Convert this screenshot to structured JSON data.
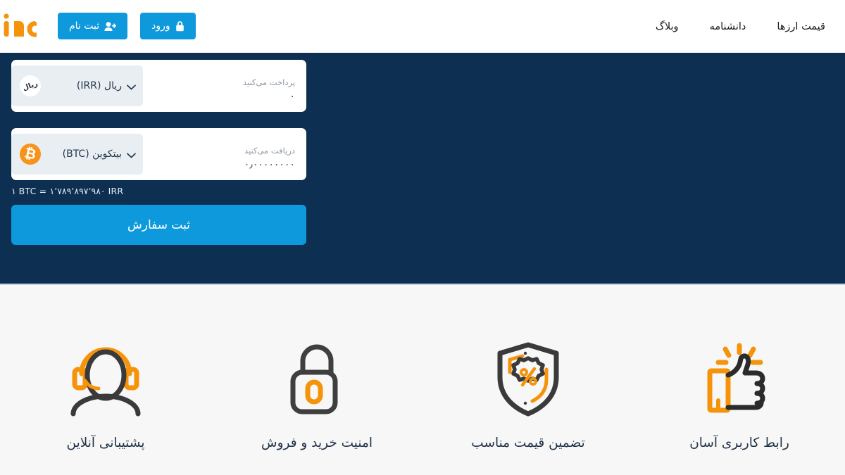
{
  "header": {
    "logo_text": "ino",
    "logo_color": "#f5a300",
    "buttons": [
      {
        "label": "ثبت نام",
        "icon": "user-plus-icon"
      },
      {
        "label": "ورود",
        "icon": "lock-icon"
      }
    ],
    "nav_links": [
      {
        "label": "قیمت ارزها"
      },
      {
        "label": "دانشنامه"
      },
      {
        "label": "وبلاگ"
      }
    ]
  },
  "hero": {
    "background_color": "#0c2f52",
    "pay_field": {
      "label": "پرداخت می‌کنید",
      "value": "۰",
      "currency_name": "ریال (IRR)",
      "currency_symbol": "ریال",
      "currency_icon": "irr-coin-icon"
    },
    "receive_field": {
      "label": "دریافت می‌کنید",
      "value": "۰٫۰۰۰۰۰۰۰۰",
      "currency_name": "بیتکوین (BTC)",
      "currency_symbol": "₿",
      "currency_icon": "btc-coin-icon"
    },
    "rate_text": "۱ BTC = ۱٬۷۸۹٬۸۹۷٬۹۸۰ IRR",
    "submit_label": "ثبت سفارش",
    "accent_color": "#0d99dc"
  },
  "features": [
    {
      "label": "پشتیبانی آنلاین",
      "icon": "headset-support-icon"
    },
    {
      "label": "امنیت خرید و فروش",
      "icon": "padlock-icon"
    },
    {
      "label": "تضمین قیمت مناسب",
      "icon": "shield-percent-icon"
    },
    {
      "label": "رابط کاربری آسان",
      "icon": "thumbs-up-icon"
    }
  ],
  "colors": {
    "accent_blue": "#0d99dc",
    "brand_orange": "#f5940b",
    "navy": "#0c2f52",
    "page_bg": "#f7f7f7",
    "icon_dark": "#3a3a3a"
  }
}
